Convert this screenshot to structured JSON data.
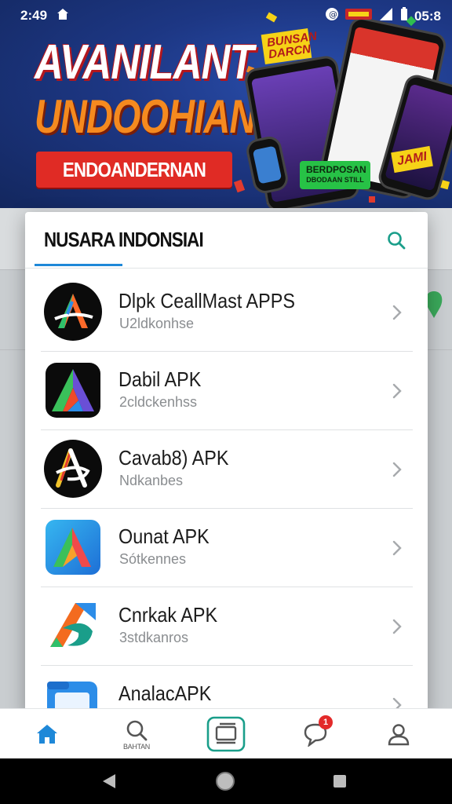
{
  "status_bar": {
    "time_left": "2:49",
    "time_right": "05:8"
  },
  "banner": {
    "headline_1": "AVANILANT",
    "headline_2": "UNDOOHIAN",
    "cta": "ENDOANDERNAN",
    "tag_1": "BUNSAN DARCN",
    "tag_2": "BERDPOSAN",
    "tag_2_sub": "DBODAAN STILL",
    "tag_3": "JAMI"
  },
  "modal": {
    "title": "NUSARA INDONSIAI",
    "items": [
      {
        "name": "Dlpk CeallMast APPS",
        "sub": "U2ldkonhse",
        "icon": "black-a-logo-icon"
      },
      {
        "name": "Dabil APK",
        "sub": "2cldckenhss",
        "icon": "gradient-a-logo-icon"
      },
      {
        "name": "Cavab8) APK",
        "sub": "Ndkanbes",
        "icon": "white-a-swirl-icon"
      },
      {
        "name": "Ounat APK",
        "sub": "Sótkennes",
        "icon": "blue-a-logo-icon"
      },
      {
        "name": "Cnrkak APK",
        "sub": "3stdkanros",
        "icon": "orange-teal-swirl-icon"
      },
      {
        "name": "AnalacAPK",
        "sub": "",
        "icon": "blue-folder-icon"
      }
    ]
  },
  "bottom_nav": {
    "home_icon": "home-icon",
    "search_label": "BAHTAN",
    "badge_count": "1"
  },
  "colors": {
    "accent": "#1e88d8",
    "brand_green": "#1a9e8a",
    "badge": "#e32a2a"
  }
}
